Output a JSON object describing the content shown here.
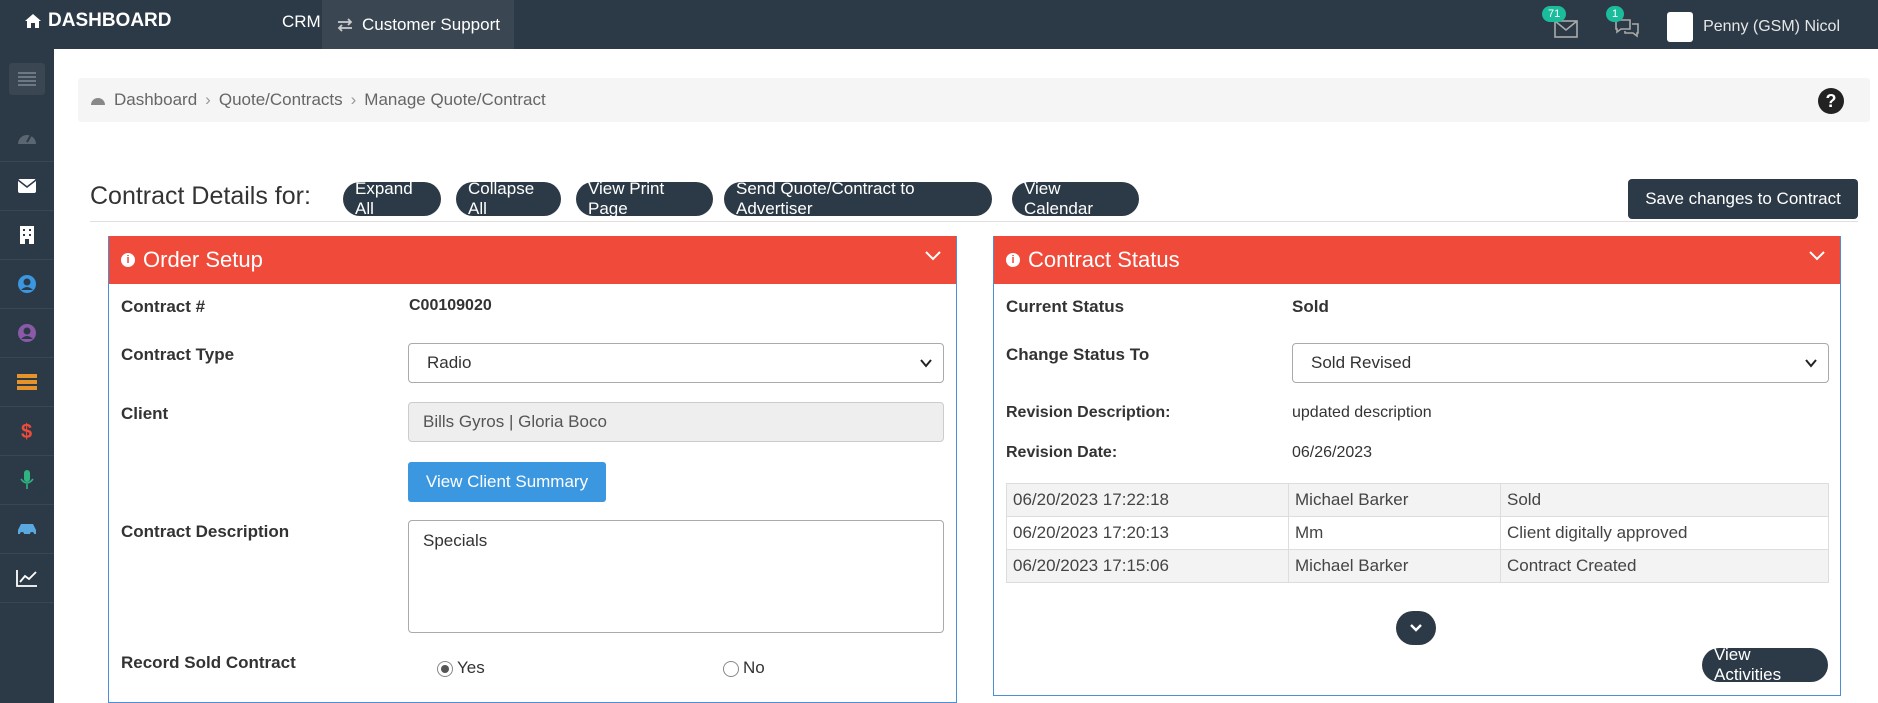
{
  "topbar": {
    "brand": "DASHBOARD",
    "crm": "CRM",
    "customer_support": "Customer Support",
    "mail_count": "71",
    "chat_count": "1",
    "user_name": "Penny (GSM) Nicol"
  },
  "sidebar": {
    "icons": [
      "menu-icon",
      "dashboard-icon",
      "mail-icon",
      "building-icon",
      "user-icon",
      "user-circle-icon",
      "stack-icon",
      "dollar-icon",
      "microphone-icon",
      "car-icon",
      "chart-icon"
    ]
  },
  "breadcrumb": {
    "items": [
      "Dashboard",
      "Quote/Contracts",
      "Manage Quote/Contract"
    ],
    "help": "?"
  },
  "toolbar": {
    "title": "Contract Details for:",
    "expand_all": "Expand All",
    "collapse_all": "Collapse All",
    "view_print": "View Print Page",
    "send_quote": "Send Quote/Contract to Advertiser",
    "view_calendar": "View Calendar",
    "save": "Save changes to Contract"
  },
  "order_setup": {
    "heading": "Order Setup",
    "contract_no_label": "Contract #",
    "contract_no": "C00109020",
    "contract_type_label": "Contract Type",
    "contract_type": "Radio",
    "client_label": "Client",
    "client": "Bills Gyros | Gloria Boco",
    "view_client_summary": "View Client Summary",
    "description_label": "Contract Description",
    "description": "Specials",
    "record_sold_label": "Record Sold Contract",
    "yes": "Yes",
    "no": "No"
  },
  "contract_status": {
    "heading": "Contract Status",
    "current_label": "Current Status",
    "current": "Sold",
    "change_label": "Change Status To",
    "change_value": "Sold Revised",
    "rev_desc_label": "Revision Description:",
    "rev_desc": "updated description",
    "rev_date_label": "Revision Date:",
    "rev_date": "06/26/2023",
    "activities": [
      {
        "time": "06/20/2023 17:22:18",
        "user": "Michael Barker",
        "action": "Sold"
      },
      {
        "time": "06/20/2023 17:20:13",
        "user": "Mm",
        "action": "Client digitally approved"
      },
      {
        "time": "06/20/2023 17:15:06",
        "user": "Michael Barker",
        "action": "Contract Created"
      }
    ],
    "view_activities": "View Activities"
  },
  "colors": {
    "navy": "#2c3a47",
    "panel_red": "#f04b3a",
    "accent_blue": "#3a97e0",
    "badge_teal": "#1abc9c"
  }
}
